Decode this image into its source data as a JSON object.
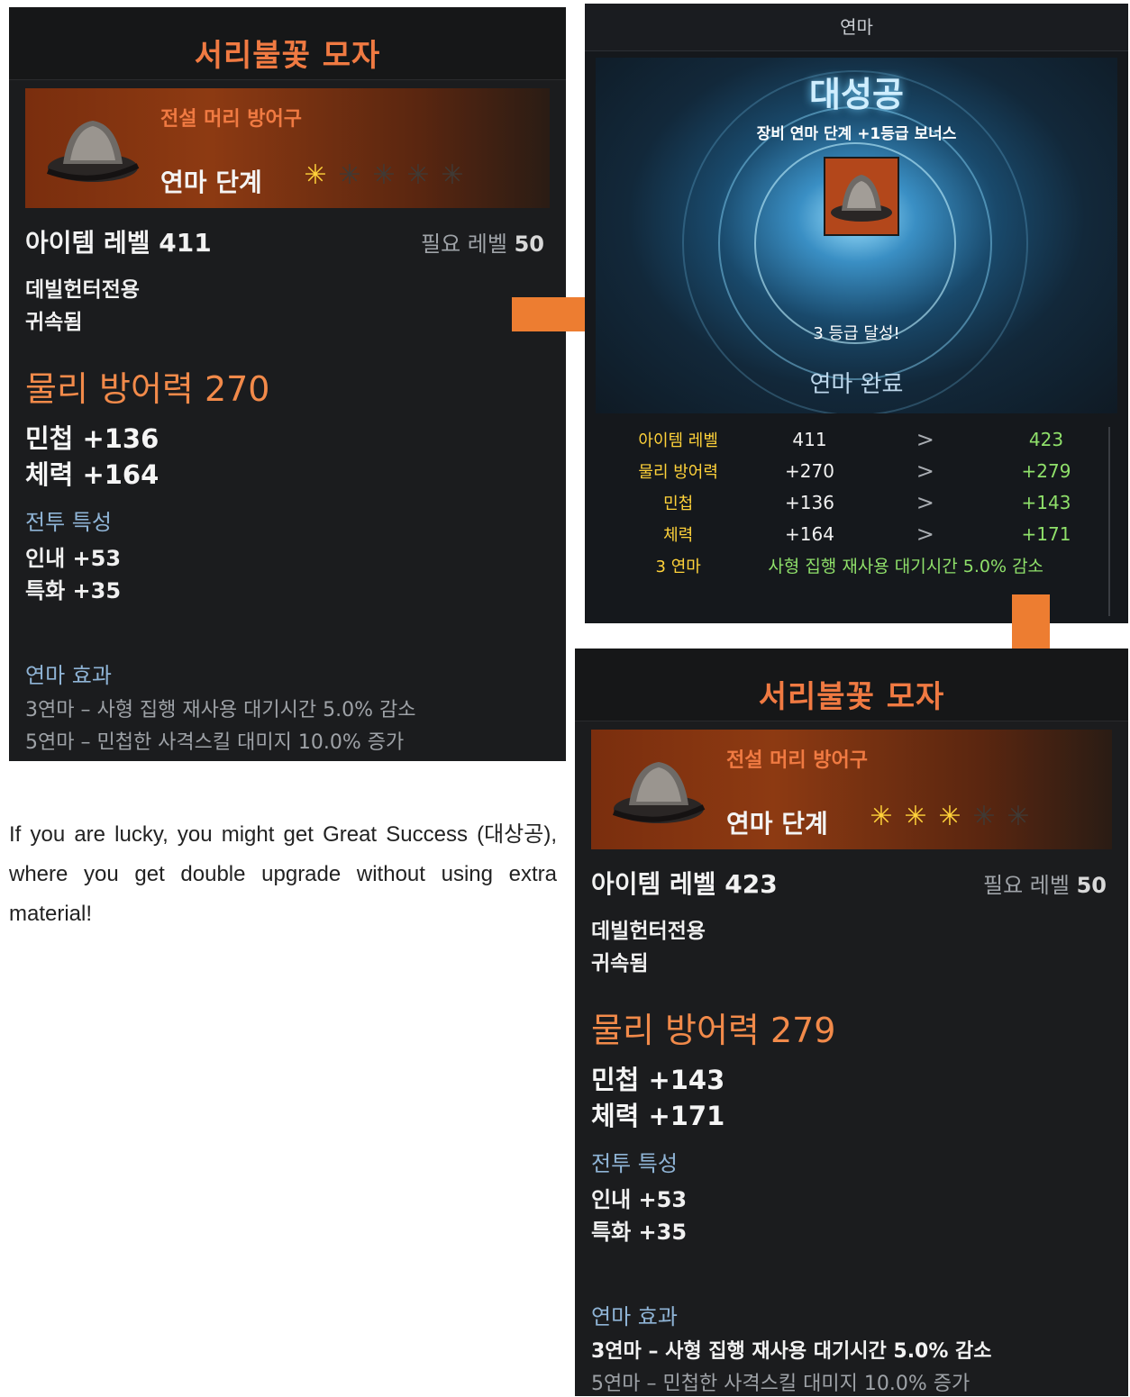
{
  "before": {
    "item_name": "서리불꽃 모자",
    "category": "전설 머리 방어구",
    "stage_label": "연마 단계",
    "stars_filled": 1,
    "stars_total": 5,
    "item_level": "아이템 레벨 411",
    "required_level_label": "필요 레벨",
    "required_level": "50",
    "class_restriction": "데빌헌터전용",
    "bound": "귀속됨",
    "defense": "물리 방어력 270",
    "stat1": "민첩 +136",
    "stat2": "체력 +164",
    "combat_header": "전투 특성",
    "combat1": "인내 +53",
    "combat2": "특화 +35",
    "effect_header": "연마 효과",
    "effect1": "3연마 – 사형 집행 재사용 대기시간 5.0% 감소",
    "effect2": "5연마 – 민첩한 사격스킬 대미지 10.0% 증가"
  },
  "after": {
    "item_name": "서리불꽃 모자",
    "category": "전설 머리 방어구",
    "stage_label": "연마 단계",
    "stars_filled": 3,
    "stars_total": 5,
    "item_level": "아이템 레벨 423",
    "required_level_label": "필요 레벨",
    "required_level": "50",
    "class_restriction": "데빌헌터전용",
    "bound": "귀속됨",
    "defense": "물리 방어력 279",
    "stat1": "민첩 +143",
    "stat2": "체력 +171",
    "combat_header": "전투 특성",
    "combat1": "인내 +53",
    "combat2": "특화 +35",
    "effect_header": "연마 효과",
    "effect1": "3연마 – 사형 집행 재사용 대기시간 5.0% 감소",
    "effect2": "5연마 – 민첩한 사격스킬 대미지 10.0% 증가"
  },
  "upgrade": {
    "header": "연마",
    "great_success": "대성공",
    "bonus": "장비 연마 단계 +1등급 보너스",
    "achieved": "3 등급 달성!",
    "complete": "연마 완료",
    "rows": [
      {
        "label": "아이템 레벨",
        "old": "411",
        "new": "423"
      },
      {
        "label": "물리 방어력",
        "old": "+270",
        "new": "+279"
      },
      {
        "label": "민첩",
        "old": "+136",
        "new": "+143"
      },
      {
        "label": "체력",
        "old": "+164",
        "new": "+171"
      }
    ],
    "effect_label": "3 연마",
    "effect_desc": "사형 집행 재사용 대기시간 5.0% 감소"
  },
  "caption": "If you are lucky, you might get Great Success (대상공), where you get double upgrade without using extra material!",
  "colors": {
    "arrow": "#ed7d31",
    "title_orange": "#f07a42",
    "star_on": "#ffd23a",
    "green_new": "#8fe06a"
  },
  "icons": [
    "hat-icon",
    "star-icon",
    "arrow-right-icon",
    "arrow-down-icon",
    "chevron-right-icon"
  ]
}
